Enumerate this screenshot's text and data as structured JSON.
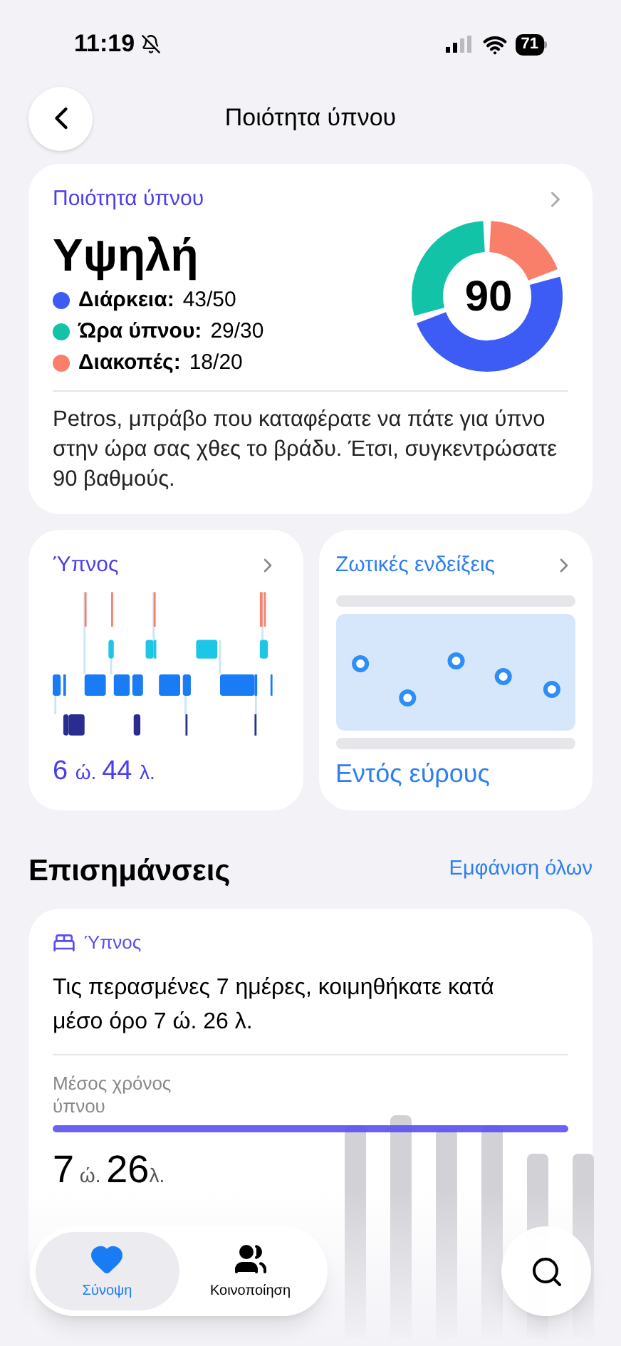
{
  "status_bar": {
    "time": "11:19",
    "battery": "71"
  },
  "header": {
    "title": "Ποιότητα ύπνου"
  },
  "quality_card": {
    "title": "Ποιότητα ύπνου",
    "rating": "Υψηλή",
    "score": "90",
    "metrics": [
      {
        "label": "Διάρκεια:",
        "value": "43/50",
        "color": "#3d5cf5"
      },
      {
        "label": "Ώρα ύπνου:",
        "value": "29/30",
        "color": "#12c3a8"
      },
      {
        "label": "Διακοπές:",
        "value": "18/20",
        "color": "#fa7f6a"
      }
    ],
    "message": "Petros, μπράβο που καταφέρατε να πάτε για ύπνο στην ώρα σας χθες το βράδυ. Έτσι, συγκεντρώσατε 90 βαθμούς."
  },
  "sleep_card": {
    "title": "Ύπνος",
    "hours": "6",
    "hours_unit": "ώ.",
    "minutes": "44",
    "minutes_unit": "λ."
  },
  "vitals_card": {
    "title": "Ζωτικές ενδείξεις",
    "status": "Εντός εύρους"
  },
  "highlights": {
    "title": "Επισημάνσεις",
    "show_all": "Εμφάνιση όλων",
    "card": {
      "category": "Ύπνος",
      "text": "Τις περασμένες 7 ημέρες, κοιμηθήκατε κατά μέσο όρο 7 ώ. 26 λ.",
      "avg_label": "Μέσος χρόνος ύπνου",
      "hours": "7",
      "hours_unit": "ώ.",
      "minutes": "26",
      "minutes_unit": "λ."
    }
  },
  "tab_bar": {
    "tabs": [
      {
        "label": "Σύνοψη",
        "selected": true,
        "kind": "heart"
      },
      {
        "label": "Κοινοποίηση",
        "selected": false,
        "kind": "people"
      }
    ]
  }
}
